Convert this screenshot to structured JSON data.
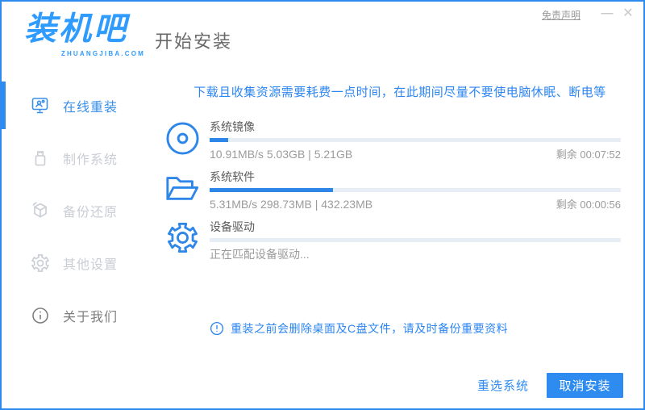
{
  "window": {
    "logo": "装机吧",
    "logo_sub": "ZHUANGJIBA.COM",
    "page_title": "开始安装",
    "disclaimer": "免责声明",
    "minimize_glyph": "—",
    "close_glyph": "✕"
  },
  "sidebar": {
    "items": [
      {
        "label": "在线重装",
        "active": true
      },
      {
        "label": "制作系统",
        "active": false
      },
      {
        "label": "备份还原",
        "active": false
      },
      {
        "label": "其他设置",
        "active": false
      },
      {
        "label": "关于我们",
        "active": false
      }
    ]
  },
  "main": {
    "warning": "下载且收集资源需要耗费一点时间，在此期间尽量不要使电脑休眠、断电等",
    "tasks": [
      {
        "label": "系统镜像",
        "progress_pct": 4.5,
        "detail": "10.91MB/s 5.03GB | 5.21GB",
        "remaining": "剩余 00:07:52"
      },
      {
        "label": "系统软件",
        "progress_pct": 30,
        "detail": "5.31MB/s 298.73MB | 432.23MB",
        "remaining": "剩余 00:00:56"
      },
      {
        "label": "设备驱动",
        "progress_pct": 0,
        "detail": "正在匹配设备驱动...",
        "remaining": ""
      }
    ],
    "note": "重装之前会删除桌面及C盘文件，请及时备份重要资料"
  },
  "footer": {
    "reselect_label": "重选系统",
    "cancel_label": "取消安装"
  },
  "colors": {
    "primary_blue": "#2e8bf0",
    "logo_blue": "#2e9bfd",
    "progress_fill": "#2e86e9",
    "progress_track": "#e8eef5",
    "info_blue": "#2c86f2",
    "label_gray": "#5b5b5b",
    "sub_gray": "#9b9b9b",
    "disabled_gray": "#c9cdd4"
  }
}
